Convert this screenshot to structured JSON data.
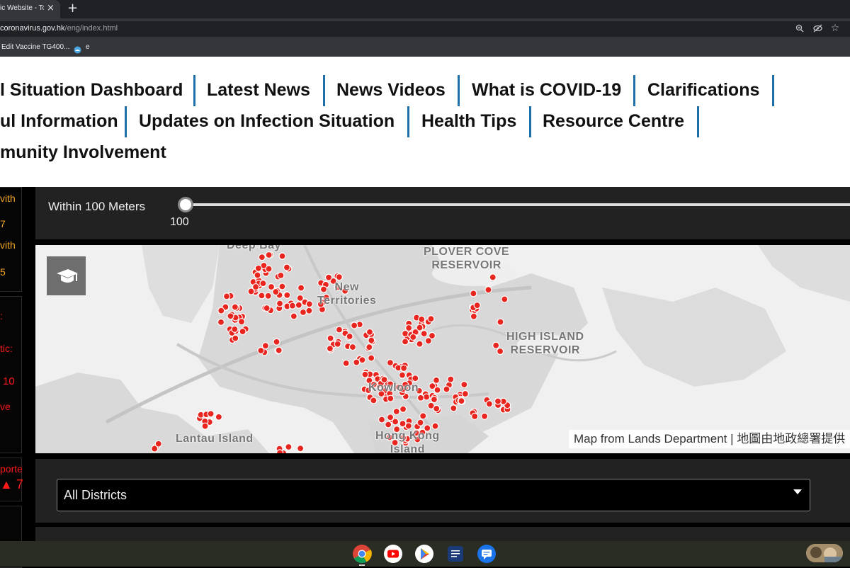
{
  "browser": {
    "tab_title": "ic Website - To",
    "tab_close": "×",
    "new_tab": "+",
    "url_host": "coronavirus.gov.hk",
    "url_path": "/eng/index.html",
    "bookmarks": [
      "Edit Vaccine TG400...",
      "e"
    ]
  },
  "nav": {
    "row1": [
      "l Situation Dashboard",
      "Latest News",
      "News Videos",
      "What is COVID-19",
      "Clarifications"
    ],
    "row2": [
      "ul Information",
      "Updates on Infection Situation",
      "Health Tips",
      "Resource Centre"
    ],
    "row3": [
      "munity Involvement"
    ]
  },
  "left_panel": {
    "lines": [
      "vith",
      "7",
      "vith",
      "5",
      ":",
      "tic:",
      "10",
      "ve",
      "porte",
      "▲ 7"
    ]
  },
  "slider": {
    "label": "Within 100 Meters",
    "value": "100"
  },
  "map": {
    "labels": [
      "PLOVER COVE\nRESERVOIR",
      "New\nTerritories",
      "HIGH ISLAND\nRESERVOIR",
      "Kowloon",
      "Lantau Island",
      "Hong Kong\nIsland",
      "Deep Bay"
    ],
    "attribution": "Map from Lands Department | 地圖由地政總署提供",
    "marker_color": "#e8261f"
  },
  "district": {
    "selected": "All Districts"
  },
  "shelf": {
    "apps": [
      "chrome-icon",
      "youtube-icon",
      "play-store-icon",
      "news-icon",
      "messages-icon"
    ]
  },
  "colors": {
    "nav_separator": "#1f6fa8",
    "warning_orange": "#f5a623",
    "alert_red": "#ff1a1a"
  }
}
